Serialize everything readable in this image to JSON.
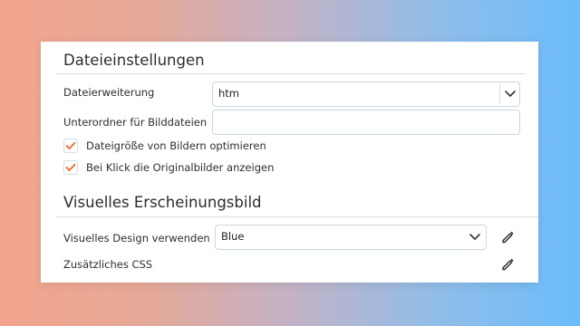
{
  "file_settings": {
    "title": "Dateieinstellungen",
    "extension_label": "Dateierweiterung",
    "extension_value": "htm",
    "subfolder_label": "Unterordner für Bilddateien",
    "subfolder_value": "",
    "checkboxes": [
      {
        "label": "Dateigröße von Bildern optimieren",
        "checked": true
      },
      {
        "label": "Bei Klick die Originalbilder anzeigen",
        "checked": true
      }
    ]
  },
  "appearance": {
    "title": "Visuelles Erscheinungsbild",
    "design_label": "Visuelles Design verwenden",
    "design_value": "Blue",
    "css_label": "Zusätzliches CSS"
  },
  "icons": {
    "check": "checkmark-icon",
    "dropdown": "chevron-down-icon",
    "edit": "pencil-icon"
  },
  "colors": {
    "check_accent": "#e8783e",
    "border": "#c9d6e2"
  }
}
